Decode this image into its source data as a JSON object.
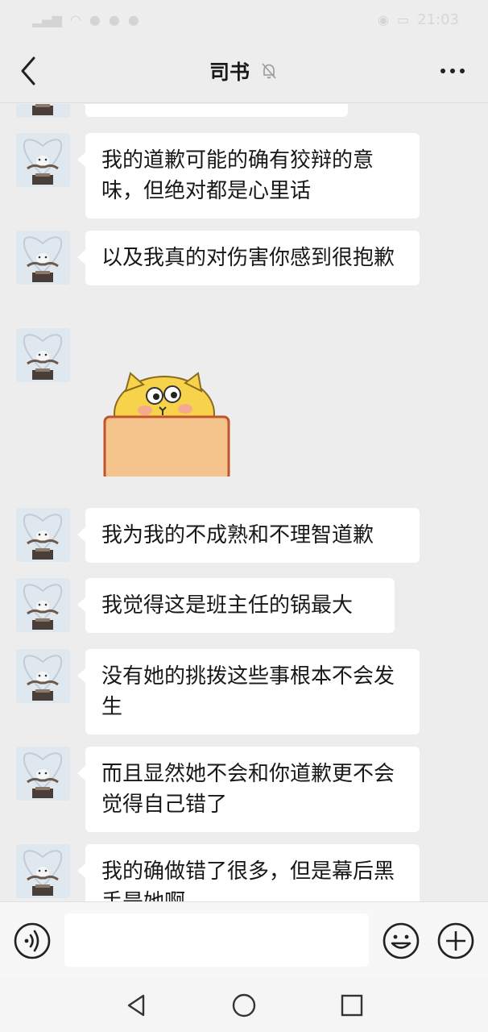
{
  "status_bar": {
    "time": "21:03",
    "icons": [
      "signal-icon",
      "wifi-icon",
      "notification-icon",
      "eye-icon",
      "battery-icon"
    ]
  },
  "header": {
    "title": "司书",
    "back_icon": "chevron-left-icon",
    "mute_icon": "bell-off-icon",
    "more_icon": "more-dots-icon"
  },
  "messages": [
    {
      "type": "text",
      "text": "我的道歉可能的确有狡辩的意味，但绝对都是心里话"
    },
    {
      "type": "text",
      "text": "以及我真的对伤害你感到很抱歉"
    },
    {
      "type": "sticker",
      "sticker": "yellow-cat-box-sticker"
    },
    {
      "type": "text",
      "text": "我为我的不成熟和不理智道歉"
    },
    {
      "type": "text",
      "text": "我觉得这是班主任的锅最大"
    },
    {
      "type": "text",
      "text": "没有她的挑拨这些事根本不会发生"
    },
    {
      "type": "text",
      "text": "而且显然她不会和你道歉更不会觉得自己错了"
    },
    {
      "type": "text",
      "text": "我的确做错了很多，但是幕后黑手是她啊"
    }
  ],
  "input_bar": {
    "value": "",
    "voice_icon": "voice-icon",
    "emoji_icon": "emoji-icon",
    "plus_icon": "plus-icon"
  },
  "nav_bar": {
    "back_icon": "nav-back-icon",
    "home_icon": "nav-home-icon",
    "recent_icon": "nav-recent-icon"
  },
  "colors": {
    "background": "#ededed",
    "bubble": "#ffffff",
    "input_bar": "#f7f7f7"
  }
}
